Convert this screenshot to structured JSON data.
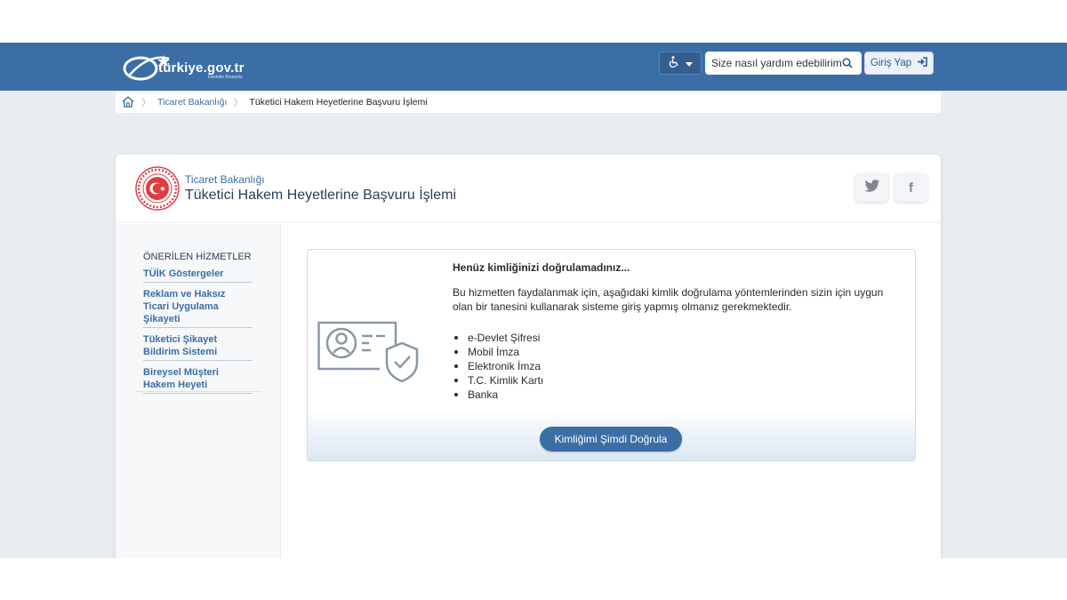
{
  "header": {
    "logo_text": "türkiye.gov.tr",
    "logo_subtext": "Devletin Kısayolu",
    "accessibility_icon": "wheelchair-icon",
    "search_placeholder": "Size nasıl yardım edebilirim?",
    "login_label": "Giriş Yap",
    "brand_color": "#3a6ea5"
  },
  "breadcrumb": {
    "items": [
      {
        "label": "Ticaret Bakanlığı"
      },
      {
        "label": "Tüketici Hakem Heyetlerine Başvuru İşlemi"
      }
    ]
  },
  "service": {
    "ministry": "Ticaret Bakanlığı",
    "title": "Tüketici Hakem Heyetlerine Başvuru İşlemi",
    "share": {
      "twitter_icon": "twitter-icon",
      "facebook_icon": "facebook-icon",
      "facebook_glyph": "f"
    }
  },
  "sidebar": {
    "title": "ÖNERİLEN HİZMETLER",
    "items": [
      {
        "label": "TÜİK Göstergeler"
      },
      {
        "label": "Reklam ve Haksız Ticari Uygulama Şikayeti"
      },
      {
        "label": "Tüketici Şikayet Bildirim Sistemi"
      },
      {
        "label": "Bireysel Müşteri Hakem Heyeti"
      }
    ]
  },
  "auth_panel": {
    "heading": "Henüz kimliğinizi doğrulamadınız...",
    "description": "Bu hizmetten faydalanmak için, aşağıdaki kimlik doğrulama yöntemlerinden sizin için uygun olan bir tanesini kullanarak sisteme giriş yapmış olmanız gerekmektedir.",
    "methods": [
      {
        "label": "e-Devlet Şifresi"
      },
      {
        "label": "Mobil İmza"
      },
      {
        "label": "Elektronik İmza"
      },
      {
        "label": "T.C. Kimlik Kartı"
      },
      {
        "label": "Banka"
      }
    ],
    "verify_button": "Kimliğimi Şimdi Doğrula"
  }
}
